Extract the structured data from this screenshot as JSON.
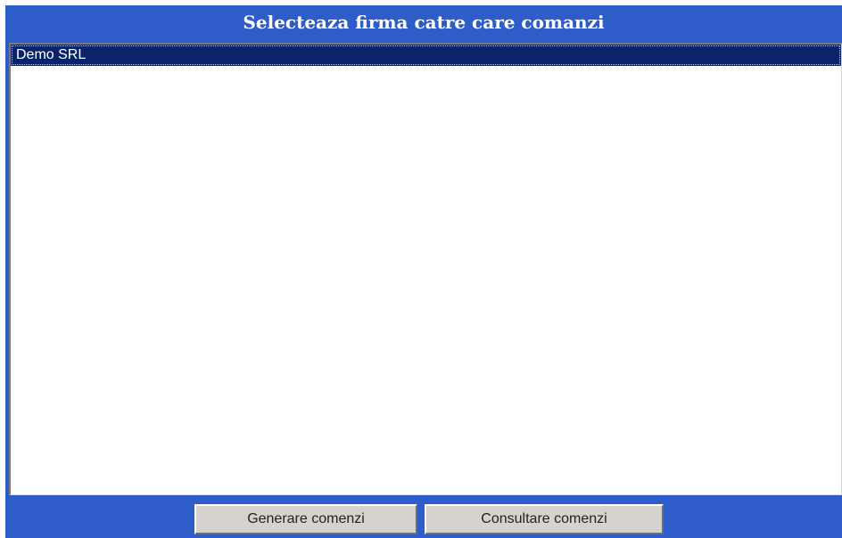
{
  "window": {
    "title": "Selecteaza firma catre care comanzi"
  },
  "company_list": {
    "items": [
      {
        "label": "Demo SRL",
        "selected": true
      }
    ]
  },
  "footer": {
    "generate_label": "Generare comenzi",
    "consult_label": "Consultare comenzi"
  },
  "colors": {
    "panel_blue": "#2e5cc8",
    "selection_navy": "#0a246a",
    "button_gray": "#d6d3ce"
  }
}
